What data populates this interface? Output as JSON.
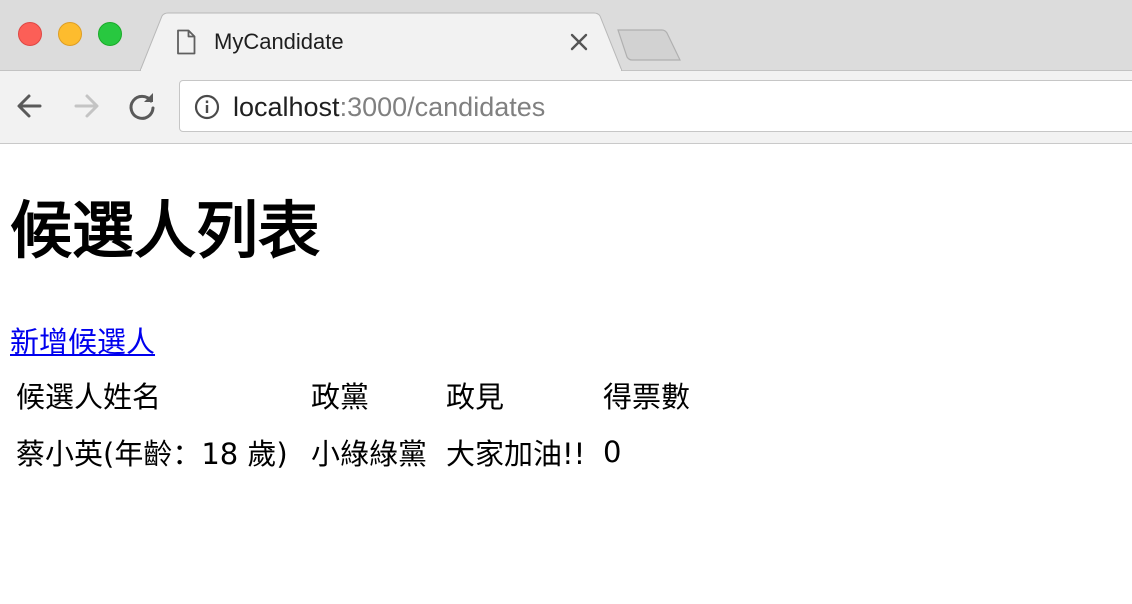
{
  "browser": {
    "tab_title": "MyCandidate",
    "url_host": "localhost",
    "url_path": ":3000/candidates",
    "colors": {
      "close": "#fc5f57",
      "minimize": "#fdbc2e",
      "maximize": "#28c840"
    }
  },
  "page": {
    "title": "候選人列表",
    "add_link": "新增候選人",
    "link_color": "#0000ee"
  },
  "table": {
    "headers": [
      "候選人姓名",
      "政黨",
      "政見",
      "得票數"
    ],
    "rows": [
      [
        "蔡小英(年齡：18 歲)",
        "小綠綠黨",
        "大家加油!!",
        "0"
      ]
    ]
  }
}
